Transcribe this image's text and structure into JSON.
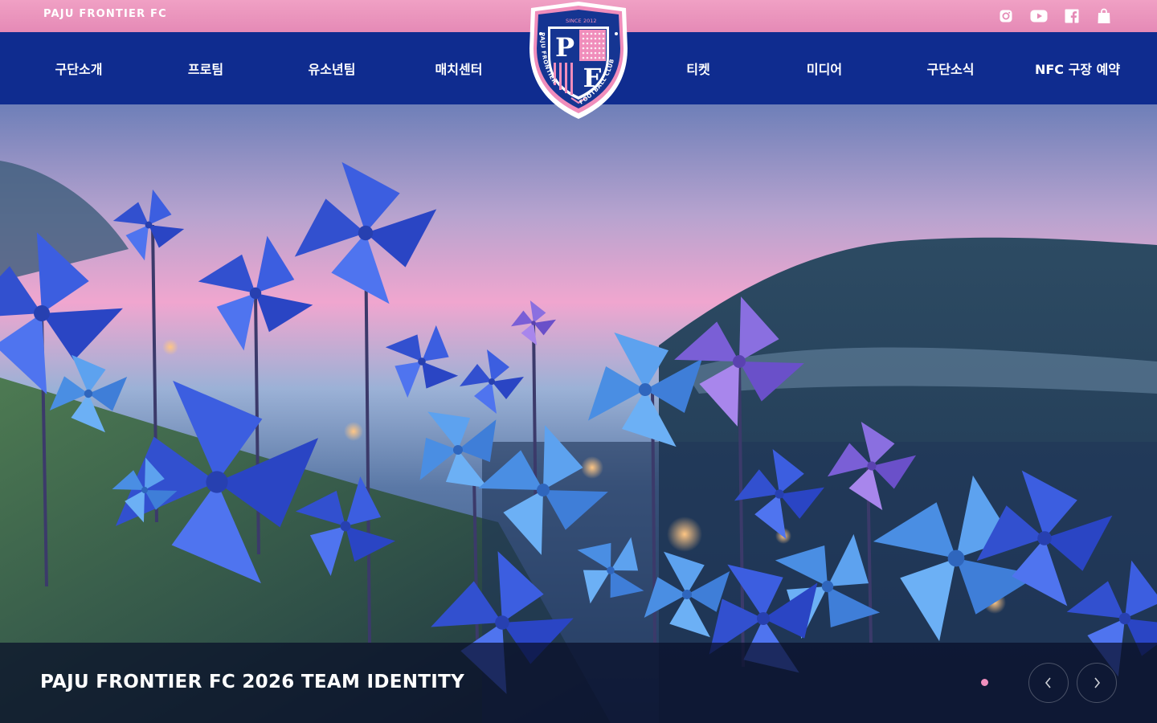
{
  "topbar": {
    "brand": "PAJU FRONTIER FC",
    "icons": [
      "instagram-icon",
      "youtube-icon",
      "facebook-icon",
      "shopping-bag-icon"
    ],
    "color": "#e58ab6"
  },
  "logo": {
    "since": "SINCE",
    "year": "2012",
    "letter_p": "P",
    "letter_f": "F",
    "ring_left": "PAJU FRONTIER",
    "ring_right": "FOOTBALL CLUB"
  },
  "nav": {
    "left": [
      "구단소개",
      "프로팀",
      "유소년팀",
      "매치센터"
    ],
    "right": [
      "티켓",
      "미디어",
      "구단소식",
      "NFC 구장 예약"
    ],
    "color": "#0f2c8f"
  },
  "hero": {
    "title": "PAJU FRONTIER FC 2026 TEAM IDENTITY",
    "slides": 1,
    "active_slide": 1,
    "accent": "#ef8fbd"
  }
}
